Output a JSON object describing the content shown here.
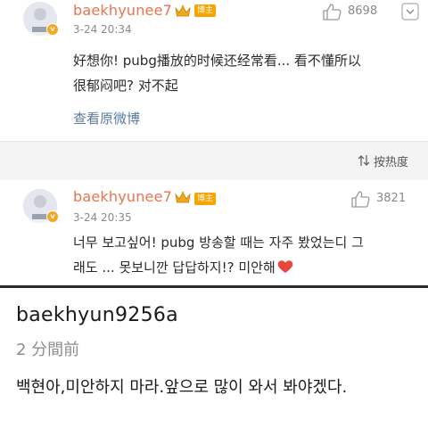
{
  "comment1": {
    "username": "baekhyunee7",
    "badge": "博主",
    "timestamp": "3-24 20:34",
    "like_count": "8698",
    "text_line1": "好想你! pubg播放的时候还经常看... 看不懂所以",
    "text_line2": "很郁闷吧? 对不起",
    "view_original": "查看原微博"
  },
  "sort_bar": {
    "label": "按热度"
  },
  "comment2": {
    "username": "baekhyunee7",
    "badge": "博主",
    "timestamp": "3-24 20:35",
    "like_count": "3821",
    "text_line1": "너무 보고싶어! pubg 방송할 때는 자주 봤었는디 그",
    "text_line2": "래도 ... 못보니깐 답답하지!? 미안해"
  },
  "reply": {
    "username": "baekhyun9256a",
    "timestamp": "2 分間前",
    "text": "백현아,미안하지 마라.앞으로 많이 와서 봐야겠다."
  },
  "colors": {
    "username": "#eb7350",
    "link": "#5b7ba5",
    "badge": "#f7a400",
    "heart": "#e8473b"
  },
  "icons": {
    "like": "thumbs-up-icon",
    "menu": "chevron-down-icon",
    "crown": "crown-icon",
    "sort": "sort-arrows-icon",
    "heart": "heart-icon"
  }
}
